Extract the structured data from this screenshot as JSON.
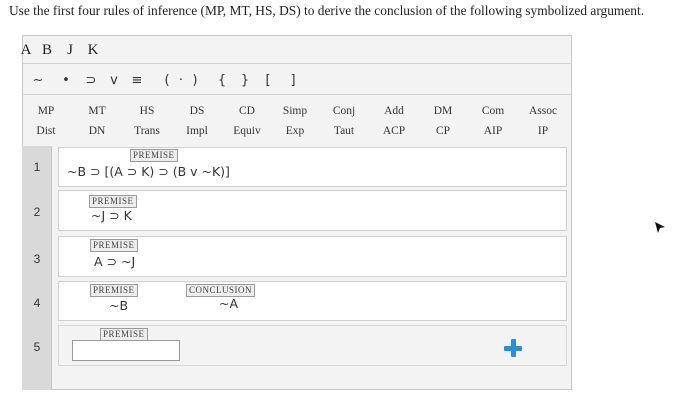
{
  "instruction": "Use the first four rules of inference (MP, MT, HS, DS) to derive the conclusion of the following symbolized argument.",
  "variables": [
    "A",
    "B",
    "J",
    "K"
  ],
  "symbols": [
    "~",
    "•",
    "⊃",
    "v",
    "≡",
    "(",
    "·",
    ")",
    "{",
    "}",
    "[",
    "]"
  ],
  "rules_row1": [
    "MP",
    "MT",
    "HS",
    "DS",
    "CD",
    "Simp",
    "Conj",
    "Add",
    "DM",
    "Com",
    "Assoc"
  ],
  "rules_row2": [
    "Dist",
    "DN",
    "Trans",
    "Impl",
    "Equiv",
    "Exp",
    "Taut",
    "ACP",
    "CP",
    "AIP",
    "IP"
  ],
  "lines": [
    {
      "num": "1",
      "tag": "PREMISE",
      "formula": "~B ⊃ [(A ⊃ K) ⊃ (B v ~K)]"
    },
    {
      "num": "2",
      "tag": "PREMISE",
      "formula": "~J ⊃ K"
    },
    {
      "num": "3",
      "tag": "PREMISE",
      "formula": "A ⊃ ~J"
    },
    {
      "num": "4",
      "tag": "PREMISE",
      "formula": "~B",
      "conclusion_tag": "CONCLUSION",
      "conclusion": "~A"
    },
    {
      "num": "5",
      "tag": "PREMISE",
      "formula": ""
    }
  ],
  "icons": {
    "add_line": "plus-icon",
    "cursor": "mouse-cursor-icon"
  },
  "colors": {
    "accent": "#2a8fd4",
    "panel": "#f3f3f3",
    "sidebar": "#d9d9d9"
  }
}
